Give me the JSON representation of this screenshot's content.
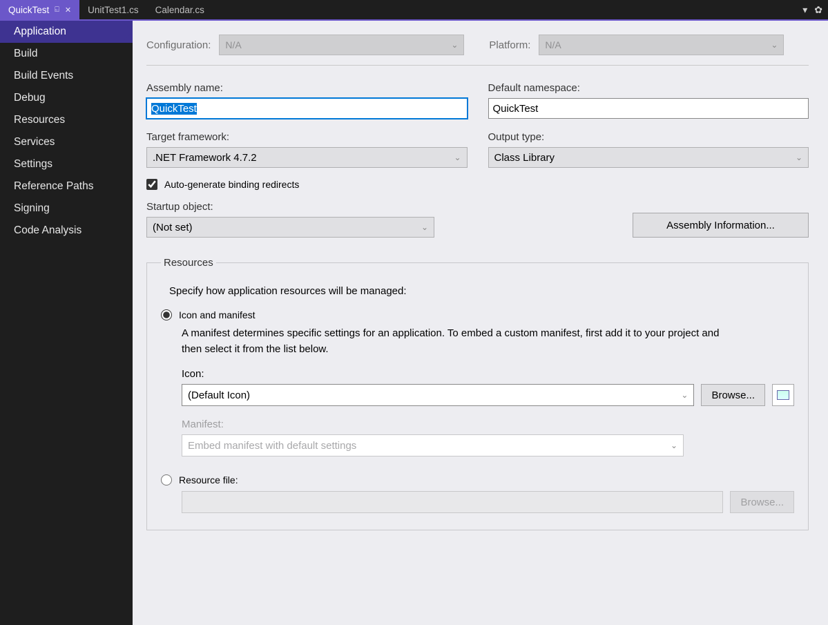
{
  "tabs": [
    {
      "label": "QuickTest",
      "active": true
    },
    {
      "label": "UnitTest1.cs",
      "active": false
    },
    {
      "label": "Calendar.cs",
      "active": false
    }
  ],
  "sidebar": [
    "Application",
    "Build",
    "Build Events",
    "Debug",
    "Resources",
    "Services",
    "Settings",
    "Reference Paths",
    "Signing",
    "Code Analysis"
  ],
  "top": {
    "configLabel": "Configuration:",
    "configValue": "N/A",
    "platformLabel": "Platform:",
    "platformValue": "N/A"
  },
  "form": {
    "assemblyNameLabel": "Assembly name:",
    "assemblyName": "QuickTest",
    "defaultNamespaceLabel": "Default namespace:",
    "defaultNamespace": "QuickTest",
    "targetFrameworkLabel": "Target framework:",
    "targetFramework": ".NET Framework 4.7.2",
    "outputTypeLabel": "Output type:",
    "outputType": "Class Library",
    "autoBindingLabel": "Auto-generate binding redirects",
    "startupLabel": "Startup object:",
    "startupValue": "(Not set)",
    "assemblyInfoBtn": "Assembly Information..."
  },
  "resources": {
    "legend": "Resources",
    "desc": "Specify how application resources will be managed:",
    "iconManifestLabel": "Icon and manifest",
    "iconManifestText": "A manifest determines specific settings for an application. To embed a custom manifest, first add it to your project and then select it from the list below.",
    "iconLabel": "Icon:",
    "iconValue": "(Default Icon)",
    "browse": "Browse...",
    "manifestLabel": "Manifest:",
    "manifestValue": "Embed manifest with default settings",
    "resourceFileLabel": "Resource file:"
  }
}
